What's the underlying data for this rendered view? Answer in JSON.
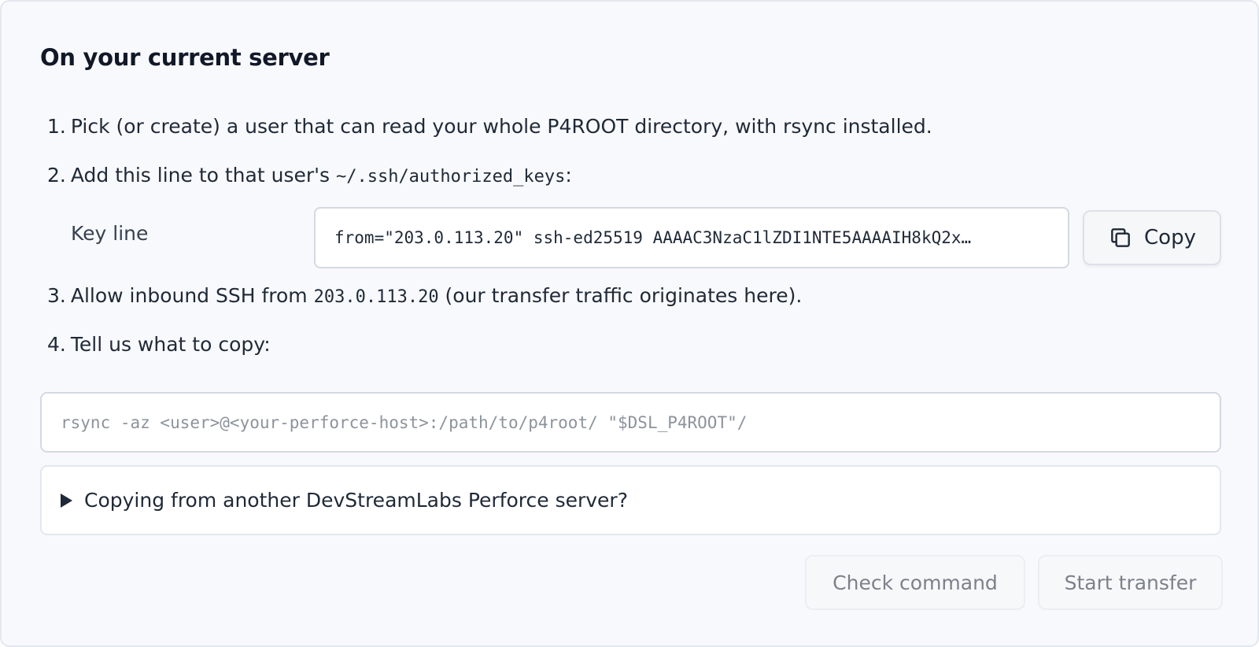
{
  "section": {
    "title": "On your current server"
  },
  "steps": [
    {
      "num": "1.",
      "text": "Pick (or create) a user that can read your whole P4ROOT directory, with rsync installed."
    },
    {
      "num": "2.",
      "before": "Add this line to that user's ",
      "code": "~/.ssh/authorized_keys",
      "after": ":"
    },
    {
      "num": "3.",
      "before": "Allow inbound SSH from ",
      "code": "203.0.113.20",
      "after": " (our transfer traffic originates here)."
    },
    {
      "num": "4.",
      "text": "Tell us what to copy:"
    }
  ],
  "key_line": {
    "label": "Key line",
    "value": "from=\"203.0.113.20\" ssh-ed25519 AAAAC3NzaC1lZDI1NTE5AAAAIH8kQ2x…",
    "copy_label": "Copy",
    "copy_icon": "copy-icon"
  },
  "command": {
    "value": "",
    "placeholder": "rsync -az <user>@<your-perforce-host>:/path/to/p4root/ \"$DSL_P4ROOT\"/"
  },
  "details": {
    "summary": "Copying from another DevStreamLabs Perforce server?",
    "icon": "triangle-right-icon"
  },
  "actions": {
    "check_label": "Check command",
    "start_label": "Start transfer"
  }
}
